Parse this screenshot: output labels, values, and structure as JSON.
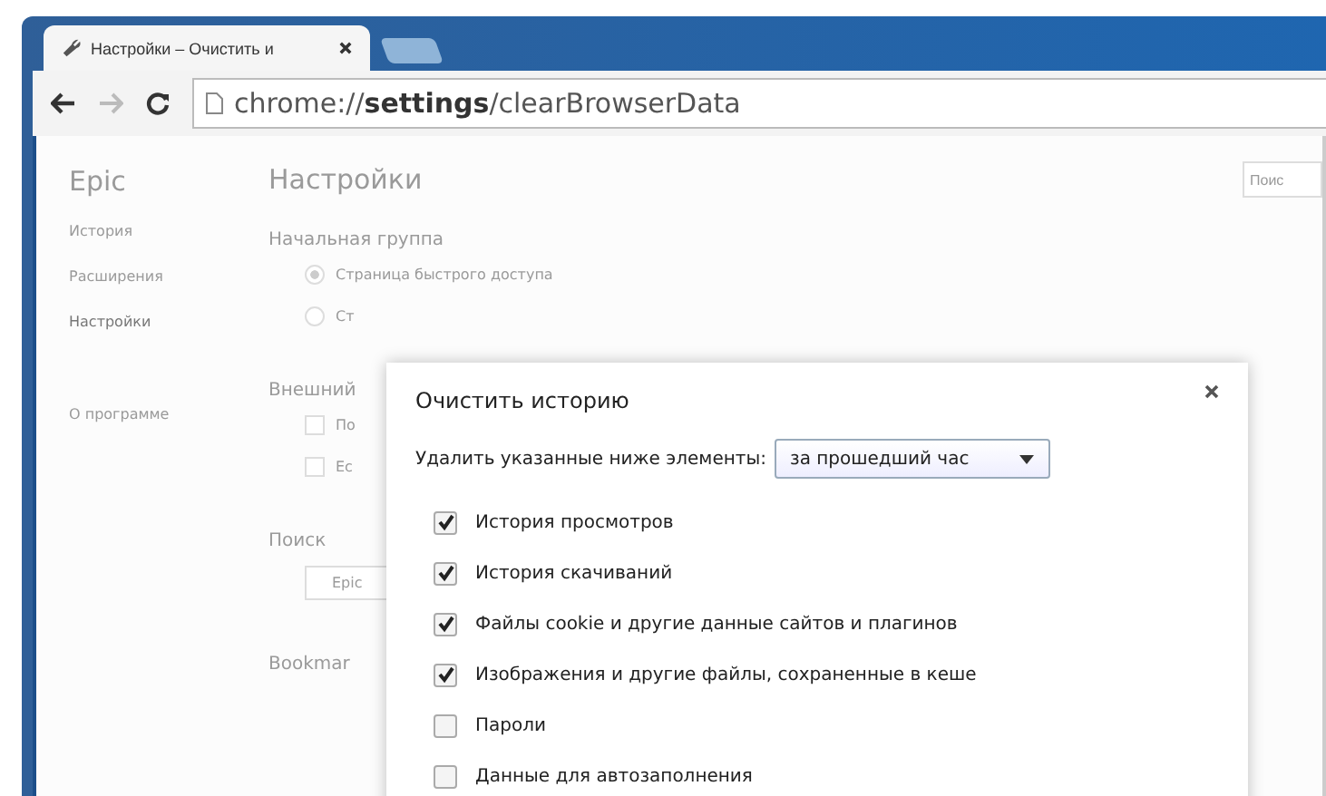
{
  "tabs": [
    {
      "title": "Настройки – Очистить и",
      "selected": true
    }
  ],
  "address_bar": {
    "scheme": "chrome://",
    "host": "settings",
    "path": "/clearBrowserData"
  },
  "sidebar": {
    "brand": "Epic",
    "items": [
      {
        "label": "История",
        "selected": false
      },
      {
        "label": "Расширения",
        "selected": false
      },
      {
        "label": "Настройки",
        "selected": true
      },
      {
        "label": "О программе",
        "selected": false
      }
    ]
  },
  "settings": {
    "title": "Настройки",
    "search_placeholder": "Поис",
    "sections": [
      {
        "heading": "Начальная группа",
        "options": [
          {
            "kind": "radio",
            "label": "Страница быстрого доступа",
            "checked": true
          },
          {
            "kind": "radio",
            "label": "Ст",
            "checked": false
          }
        ]
      },
      {
        "heading": "Внешний",
        "options": [
          {
            "kind": "checkbox",
            "label": "По",
            "checked": false
          },
          {
            "kind": "checkbox",
            "label": "Ес",
            "checked": false
          }
        ]
      },
      {
        "heading": "Поиск",
        "options": [
          {
            "kind": "field",
            "label": "Epic"
          }
        ]
      },
      {
        "heading": "Bookmar"
      }
    ]
  },
  "dialog": {
    "title": "Очистить историю",
    "range_label": "Удалить указанные ниже элементы:",
    "range_value": "за прошедший час",
    "items": [
      {
        "label": "История просмотров",
        "checked": true
      },
      {
        "label": "История скачиваний",
        "checked": true
      },
      {
        "label": "Файлы cookie и другие данные сайтов и плагинов",
        "checked": true
      },
      {
        "label": "Изображения и другие файлы, сохраненные в кеше",
        "checked": true
      },
      {
        "label": "Пароли",
        "checked": false
      },
      {
        "label": "Данные для автозаполнения",
        "checked": false
      }
    ]
  }
}
